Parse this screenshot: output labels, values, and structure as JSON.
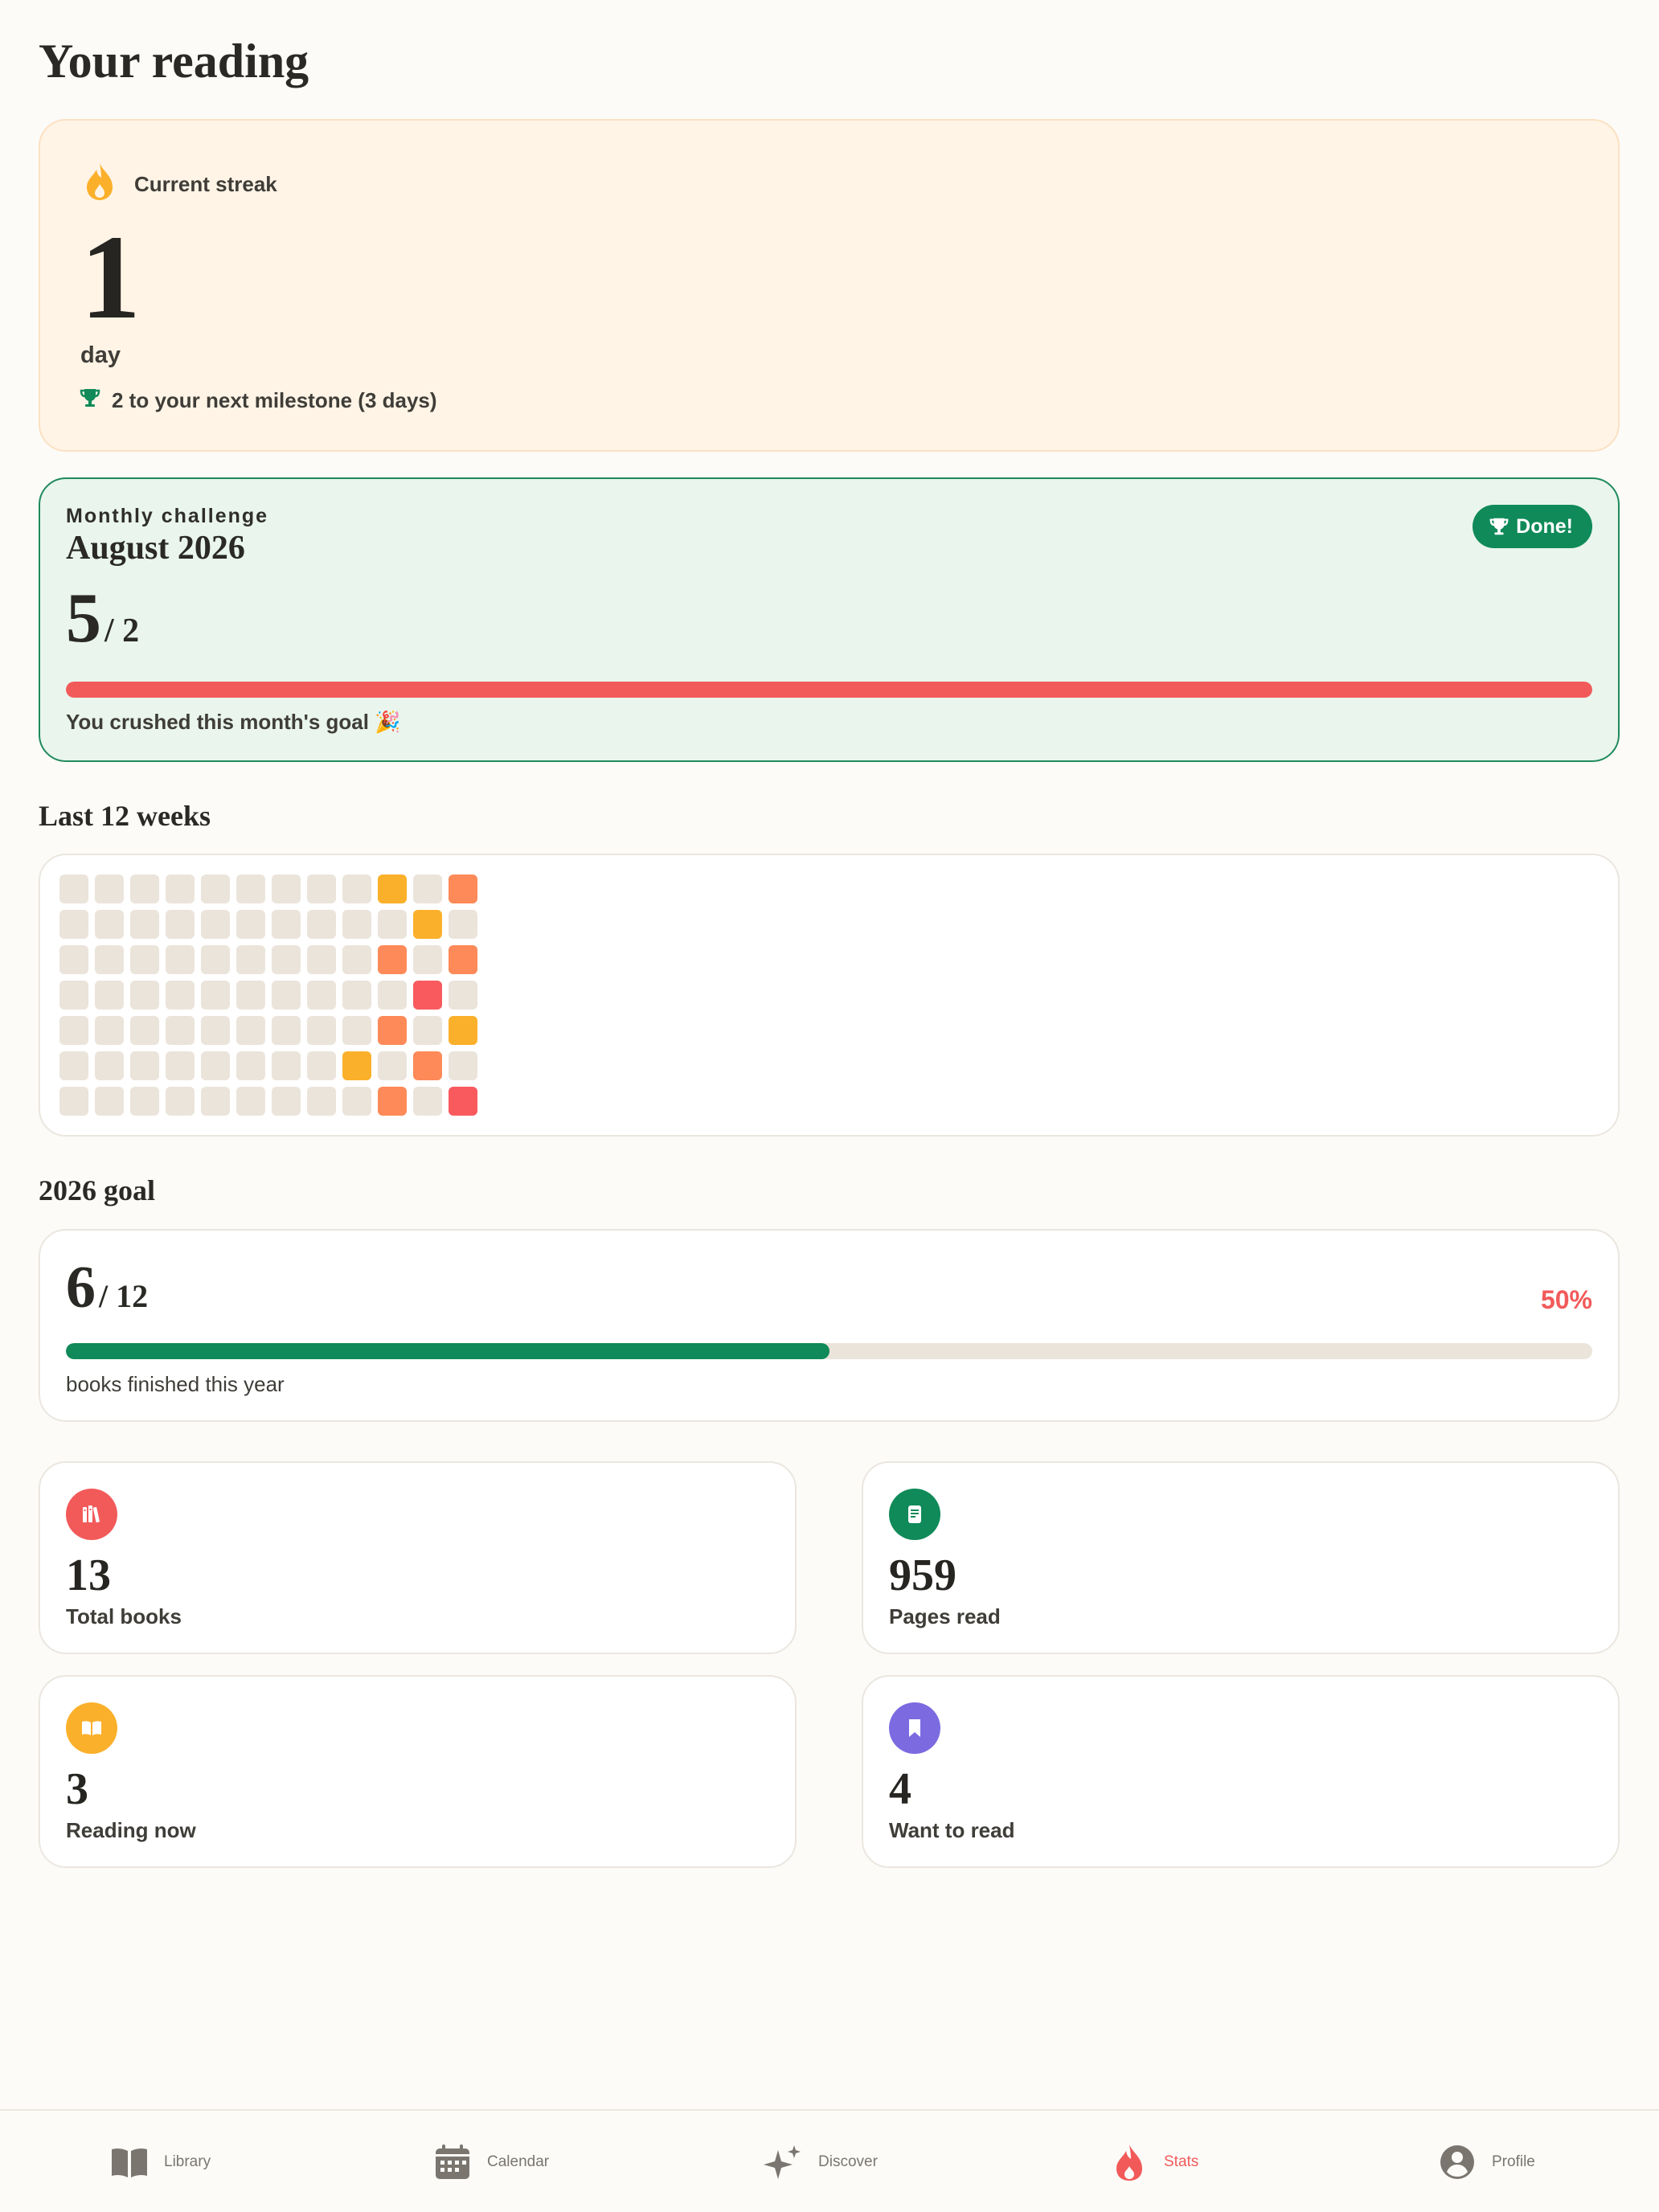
{
  "page": {
    "title": "Your reading"
  },
  "streak": {
    "label": "Current streak",
    "value": "1",
    "unit": "day",
    "milestone": "2 to your next milestone (3 days)"
  },
  "challenge": {
    "kicker": "Monthly challenge",
    "month": "August 2026",
    "done": "5",
    "target": "/ 2",
    "badge": "Done!",
    "progress": 1.0,
    "message": "You crushed this month's goal 🎉",
    "bar_color": "#f25a5a"
  },
  "weeks": {
    "title": "Last 12 weeks",
    "columns": 12,
    "rows": 7,
    "levels": {
      "0": "#ebe4db",
      "1": "#fbb02b",
      "2": "#fd8a58",
      "3": "#f85a5e"
    },
    "grid": [
      [
        0,
        0,
        0,
        0,
        0,
        0,
        0
      ],
      [
        0,
        0,
        0,
        0,
        0,
        0,
        0
      ],
      [
        0,
        0,
        0,
        0,
        0,
        0,
        0
      ],
      [
        0,
        0,
        0,
        0,
        0,
        0,
        0
      ],
      [
        0,
        0,
        0,
        0,
        0,
        0,
        0
      ],
      [
        0,
        0,
        0,
        0,
        0,
        0,
        0
      ],
      [
        0,
        0,
        0,
        0,
        0,
        0,
        0
      ],
      [
        0,
        0,
        0,
        0,
        0,
        0,
        0
      ],
      [
        0,
        0,
        0,
        0,
        0,
        1,
        0
      ],
      [
        1,
        0,
        2,
        0,
        2,
        0,
        2
      ],
      [
        0,
        1,
        0,
        3,
        0,
        2,
        0
      ],
      [
        2,
        0,
        2,
        0,
        1,
        0,
        3
      ]
    ]
  },
  "goal": {
    "title": "2026 goal",
    "done": "6",
    "target": "/ 12",
    "percent": "50%",
    "progress": 0.5,
    "subtitle": "books finished this year"
  },
  "stats": [
    {
      "value": "13",
      "label": "Total books",
      "icon": "books-icon",
      "color": "#f25a5a"
    },
    {
      "value": "959",
      "label": "Pages read",
      "icon": "page-icon",
      "color": "#0f8a58"
    },
    {
      "value": "3",
      "label": "Reading now",
      "icon": "open-book-icon",
      "color": "#fbb02b"
    },
    {
      "value": "4",
      "label": "Want to read",
      "icon": "bookmark-icon",
      "color": "#7b6ae0"
    }
  ],
  "nav": [
    {
      "label": "Library",
      "icon": "book-icon"
    },
    {
      "label": "Calendar",
      "icon": "calendar-icon"
    },
    {
      "label": "Discover",
      "icon": "sparkle-icon"
    },
    {
      "label": "Stats",
      "icon": "flame-icon",
      "active": true
    },
    {
      "label": "Profile",
      "icon": "profile-icon"
    }
  ]
}
